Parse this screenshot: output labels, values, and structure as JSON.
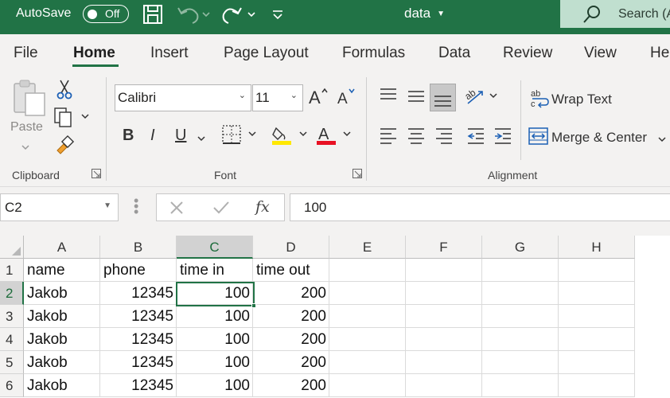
{
  "titlebar": {
    "autosave_label": "AutoSave",
    "autosave_state": "Off",
    "document_title": "data",
    "search_label": "Search (A",
    "accent_color": "#217346"
  },
  "ribbon_tabs": [
    "File",
    "Home",
    "Insert",
    "Page Layout",
    "Formulas",
    "Data",
    "Review",
    "View",
    "He"
  ],
  "active_tab": "Home",
  "clipboard": {
    "paste_label": "Paste",
    "group_label": "Clipboard"
  },
  "font": {
    "family": "Calibri",
    "size": "11",
    "bold": "B",
    "italic": "I",
    "underline": "U",
    "group_label": "Font"
  },
  "alignment": {
    "wrap_text": "Wrap Text",
    "merge_center": "Merge & Center",
    "group_label": "Alignment"
  },
  "formula_bar": {
    "name_box": "C2",
    "fx": "fx",
    "value": "100"
  },
  "grid": {
    "columns": [
      "A",
      "B",
      "C",
      "D",
      "E",
      "F",
      "G",
      "H"
    ],
    "rows": [
      "1",
      "2",
      "3",
      "4",
      "5",
      "6"
    ],
    "cells": [
      [
        "name",
        "phone",
        "time in",
        "time out",
        "",
        "",
        "",
        ""
      ],
      [
        "Jakob",
        "12345",
        "100",
        "200",
        "",
        "",
        "",
        ""
      ],
      [
        "Jakob",
        "12345",
        "100",
        "200",
        "",
        "",
        "",
        ""
      ],
      [
        "Jakob",
        "12345",
        "100",
        "200",
        "",
        "",
        "",
        ""
      ],
      [
        "Jakob",
        "12345",
        "100",
        "200",
        "",
        "",
        "",
        ""
      ],
      [
        "Jakob",
        "12345",
        "100",
        "200",
        "",
        "",
        "",
        ""
      ]
    ],
    "selected_cell": "C2"
  }
}
